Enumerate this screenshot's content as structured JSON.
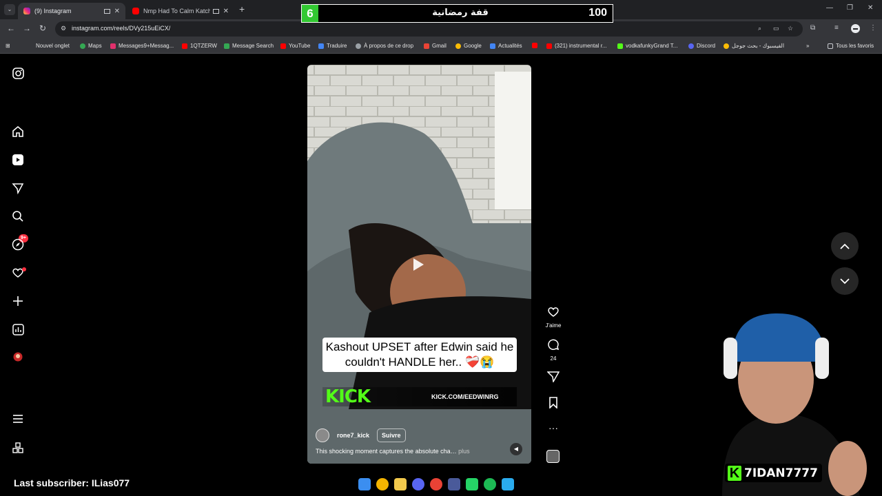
{
  "browser": {
    "tabs": [
      {
        "title": "(9) Instagram",
        "active": true
      },
      {
        "title": "Nmp Had To Calm Katchii D",
        "active": false
      }
    ],
    "url": "instagram.com/reels/DVy215uEiCX/",
    "bookmarks": [
      "Nouvel onglet",
      "Maps",
      "Messages9+Messag...",
      "1QTZERW",
      "Message Search",
      "YouTube",
      "Traduire",
      "À propos de ce drop",
      "Gmail",
      "Google",
      "Actualités",
      "(321) instrumental r...",
      "vodkafunkyGrand T...",
      "Discord",
      "الفيسبوك - بحث جوجل"
    ],
    "all_bookmarks": "Tous les favoris"
  },
  "sidebar": {
    "notification_badge": "9+"
  },
  "reel": {
    "caption": "Kashout UPSET after Edwin said he couldn't HANDLE her.. ❤️‍🩹😭",
    "kick_url": "KICK.COM/EEDWINRG",
    "kick_logo": "KICK",
    "author": "rone7_kick",
    "follow": "Suivre",
    "description": "This shocking moment captures the absolute cha…",
    "more": "plus",
    "actions": {
      "like_label": "J'aime",
      "comment_count": "24"
    }
  },
  "overlay": {
    "goal_current": "6",
    "goal_title": "قفة رمضانية",
    "goal_target": "100",
    "last_subscriber": "Last subscriber: ILias077",
    "streamer_tag": "7IDAN7777",
    "kick_k": "K"
  },
  "colors": {
    "kick_green": "#53fc18",
    "goal_green": "#32c832",
    "notification_red": "#ff3040",
    "chrome_dark": "#202124",
    "chrome_mid": "#35363a"
  }
}
